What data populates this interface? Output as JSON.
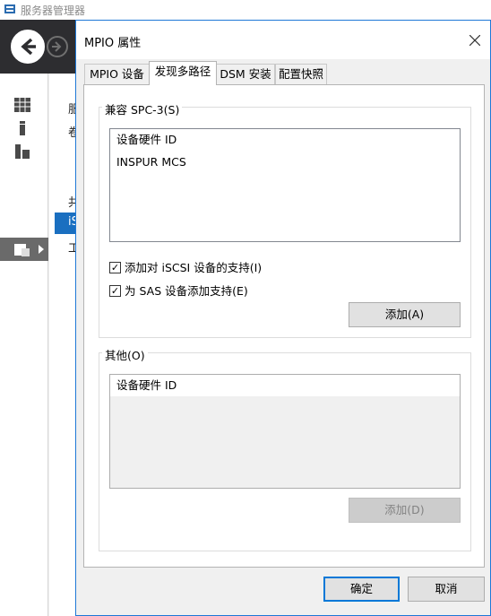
{
  "background": {
    "app_title": "服务器管理器",
    "sidebar_items": [
      {
        "icon": "dashboard-icon"
      },
      {
        "icon": "local-server-icon"
      },
      {
        "icon": "all-servers-icon"
      },
      {
        "icon": "file-storage-icon"
      }
    ],
    "partial_text": [
      "服",
      "卷",
      "共",
      "iS",
      "工"
    ]
  },
  "dialog": {
    "title": "MPIO 属性",
    "tabs": [
      {
        "label": "MPIO 设备",
        "active": false
      },
      {
        "label": "发现多路径",
        "active": true
      },
      {
        "label": "DSM 安装",
        "active": false
      },
      {
        "label": "配置快照",
        "active": false
      }
    ],
    "spc3_group": {
      "label": "兼容 SPC-3(S)",
      "list_header": "设备硬件 ID",
      "items": [
        "INSPUR  MCS"
      ],
      "checkboxes": [
        {
          "label": "添加对 iSCSI 设备的支持(I)",
          "checked": true,
          "mark": "✓"
        },
        {
          "label": "为 SAS 设备添加支持(E)",
          "checked": true,
          "mark": "✓"
        }
      ],
      "add_button": "添加(A)"
    },
    "other_group": {
      "label": "其他(O)",
      "list_header": "设备硬件 ID",
      "add_button": "添加(D)"
    },
    "ok_button": "确定",
    "cancel_button": "取消"
  }
}
